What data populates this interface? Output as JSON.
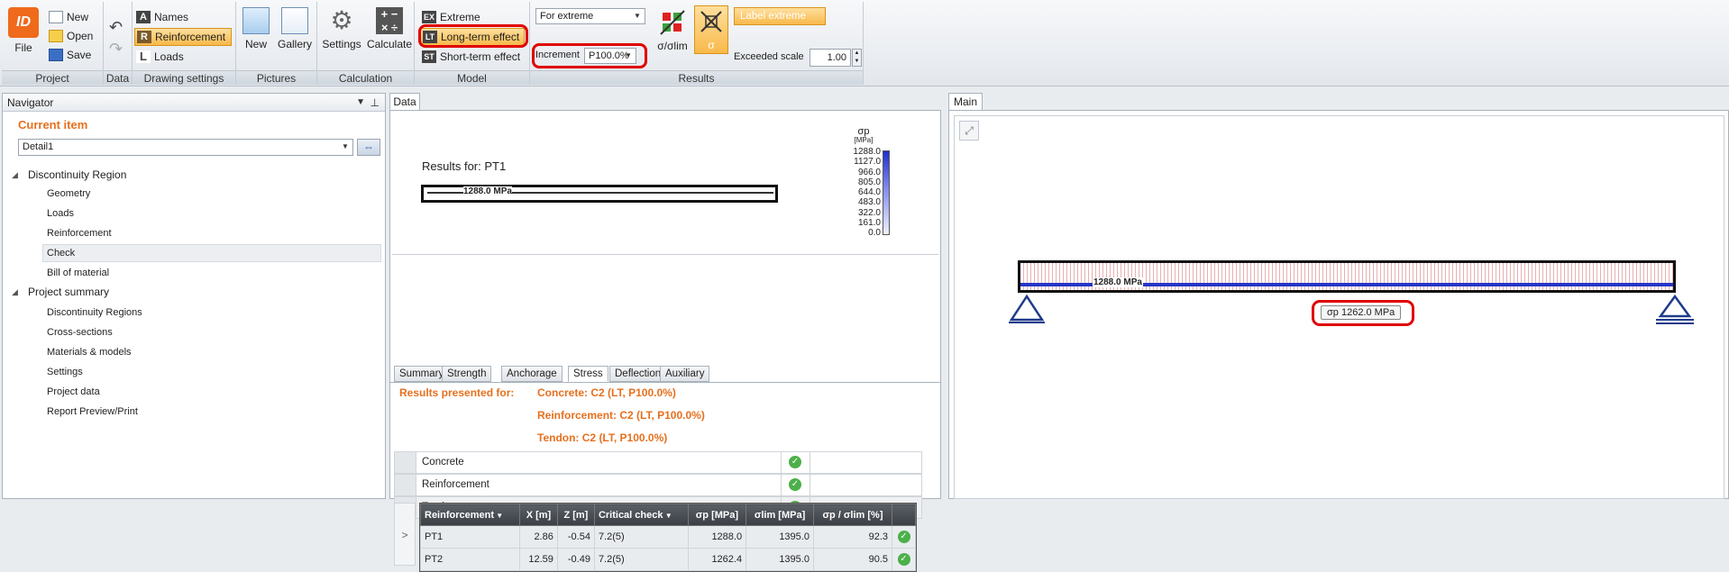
{
  "ribbon": {
    "project": {
      "title": "Project",
      "file": "File",
      "new": "New",
      "open": "Open",
      "save": "Save"
    },
    "data": {
      "title": "Data"
    },
    "drawing": {
      "title": "Drawing settings",
      "names": "Names",
      "reinforcement": "Reinforcement",
      "loads": "Loads"
    },
    "pictures": {
      "title": "Pictures",
      "new": "New",
      "gallery": "Gallery"
    },
    "calculation": {
      "title": "Calculation",
      "settings": "Settings",
      "calculate": "Calculate"
    },
    "model": {
      "title": "Model",
      "extreme": "Extreme",
      "extreme_badge": "EX",
      "long_term": "Long-term effect",
      "long_term_badge": "LT",
      "short_term": "Short-term effect",
      "short_term_badge": "ST"
    },
    "results": {
      "title": "Results",
      "mode_select": "For extreme",
      "increment_label": "Increment",
      "increment_value": "P100.0%",
      "sigma_lim": "σ/σlim",
      "sigma": "σ",
      "label_extreme": "Label extreme",
      "exceeded_scale_label": "Exceeded scale",
      "exceeded_scale_value": "1.00"
    }
  },
  "navigator": {
    "title": "Navigator",
    "pin": "ᵠ",
    "current_item_label": "Current item",
    "current_item_value": "Detail1",
    "tree": {
      "dr": "Discontinuity Region",
      "geometry": "Geometry",
      "loads": "Loads",
      "reinforcement": "Reinforcement",
      "check": "Check",
      "bom": "Bill of material",
      "ps": "Project summary",
      "ps_dr": "Discontinuity Regions",
      "cross_sections": "Cross-sections",
      "materials": "Materials & models",
      "settings": "Settings",
      "project_data": "Project data",
      "report": "Report Preview/Print"
    }
  },
  "data_panel": {
    "tab": "Data",
    "results_for": "Results for: PT1",
    "bar_value": "1288.0 MPa",
    "legend": {
      "symbol": "σp",
      "unit": "[MPa]",
      "values": [
        "1288.0",
        "1127.0",
        "966.0",
        "805.0",
        "644.0",
        "483.0",
        "322.0",
        "161.0",
        "0.0"
      ]
    },
    "subtabs": [
      "Summary",
      "Strength",
      "Anchorage",
      "Stress",
      "Deflection",
      "Auxiliary"
    ],
    "results_presented_label": "Results presented for:",
    "concrete_result": "Concrete: C2 (LT, P100.0%)",
    "reinforcement_result": "Reinforcement: C2 (LT, P100.0%)",
    "tendon_result": "Tendon: C2 (LT, P100.0%)",
    "checks": [
      "Concrete",
      "Reinforcement",
      "Tendon"
    ],
    "expand_glyph": ">",
    "table": {
      "headers": [
        "Reinforcement",
        "X [m]",
        "Z [m]",
        "Critical check",
        "σp [MPa]",
        "σlim [MPa]",
        "σp / σlim [%]"
      ],
      "rows": [
        [
          "PT1",
          "2.86",
          "-0.54",
          "7.2(5)",
          "1288.0",
          "1395.0",
          "92.3"
        ],
        [
          "PT2",
          "12.59",
          "-0.49",
          "7.2(5)",
          "1262.4",
          "1395.0",
          "90.5"
        ]
      ]
    }
  },
  "main_panel": {
    "tab": "Main",
    "beam_label": "1288.0 MPa",
    "sigma_badge": "σp 1262.0 MPa"
  },
  "colors": {
    "accent_orange": "#e6701e",
    "highlight_red": "#e00000",
    "check_green": "#4cb04a"
  }
}
